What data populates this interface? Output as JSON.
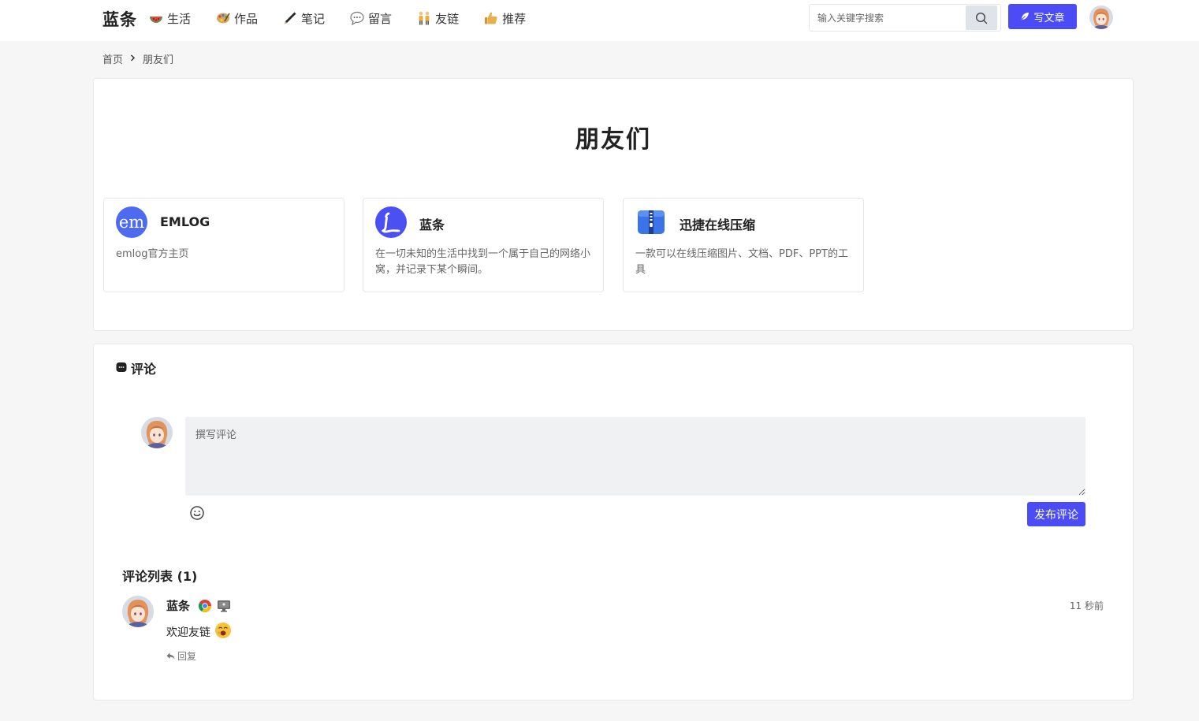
{
  "site": {
    "name": "蓝条"
  },
  "nav": [
    {
      "label": "生活",
      "icon": "watermelon-icon"
    },
    {
      "label": "作品",
      "icon": "palette-icon"
    },
    {
      "label": "笔记",
      "icon": "pen-icon"
    },
    {
      "label": "留言",
      "icon": "speech-bubble-icon"
    },
    {
      "label": "友链",
      "icon": "couple-icon"
    },
    {
      "label": "推荐",
      "icon": "thumbs-up-icon"
    }
  ],
  "search": {
    "placeholder": "输入关键字搜索"
  },
  "write_button": {
    "label": "写文章"
  },
  "breadcrumb": {
    "home": "首页",
    "current": "朋友们"
  },
  "page": {
    "title": "朋友们"
  },
  "links": [
    {
      "name": "EMLOG",
      "desc": "emlog官方主页",
      "logo_text": "em",
      "logo_color": "#4e6bf0"
    },
    {
      "name": "蓝条",
      "desc": "在一切未知的生活中找到一个属于自己的网络小窝，并记录下某个瞬间。",
      "logo_color": "#4a50f2"
    },
    {
      "name": "迅捷在线压缩",
      "desc": "一款可以在线压缩图片、文档、PDF、PPT的工具",
      "logo_color": "#3b74e8"
    }
  ],
  "comments": {
    "heading": "评论",
    "placeholder": "撰写评论",
    "publish_label": "发布评论",
    "list_title": "评论列表 (1)",
    "items": [
      {
        "author": "蓝条",
        "time": "11 秒前",
        "text": "欢迎友链",
        "reply_label": "回复"
      }
    ]
  },
  "colors": {
    "accent": "#4b4cf5",
    "background": "#f6f6f6"
  }
}
